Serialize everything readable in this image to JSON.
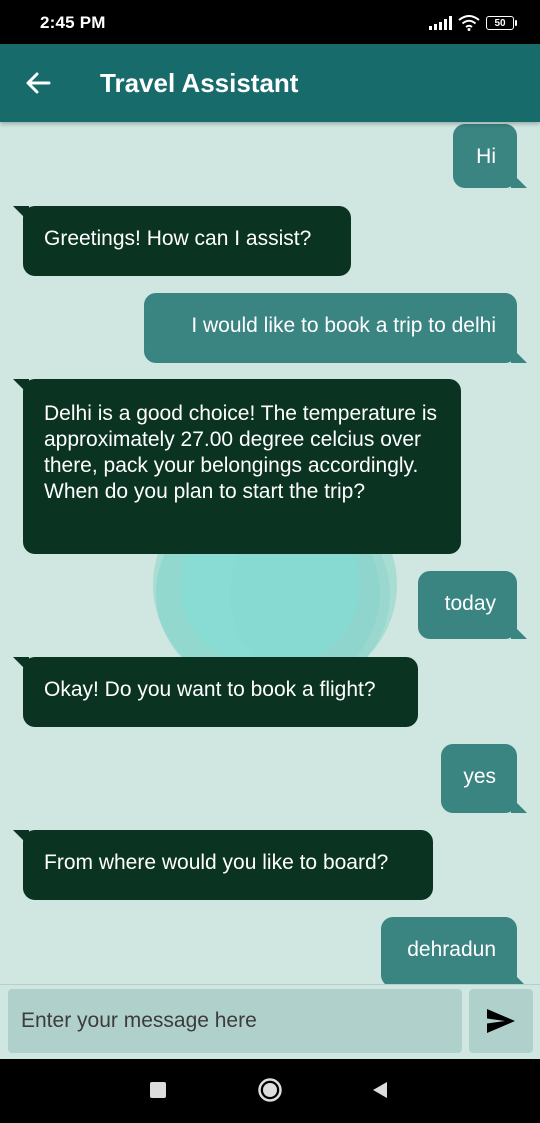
{
  "status_bar": {
    "time": "2:45 PM",
    "battery": "50",
    "icons": [
      "signal-icon",
      "wifi-icon",
      "battery-icon"
    ]
  },
  "app_bar": {
    "title": "Travel Assistant",
    "back_icon": "arrow-left-icon"
  },
  "messages": [
    {
      "sender": "user",
      "text": "Hi"
    },
    {
      "sender": "bot",
      "text": "Greetings! How can I assist?"
    },
    {
      "sender": "user",
      "text": "I would like to book a trip to delhi"
    },
    {
      "sender": "bot",
      "text": "Delhi is a good choice! The temperature is approximately 27.00 degree celcius over there, pack your belongings accordingly. When do you plan to start the trip?"
    },
    {
      "sender": "user",
      "text": "today"
    },
    {
      "sender": "bot",
      "text": "Okay! Do you want to book a flight?"
    },
    {
      "sender": "user",
      "text": "yes"
    },
    {
      "sender": "bot",
      "text": "From where would you like to board?"
    },
    {
      "sender": "user",
      "text": "dehradun"
    }
  ],
  "composer": {
    "placeholder": "Enter your message here",
    "send_icon": "send-icon"
  },
  "nav": {
    "icons": [
      "recent-apps-icon",
      "home-icon",
      "back-icon"
    ]
  },
  "colors": {
    "app_bar": "#176b6b",
    "background": "#d0e6e1",
    "bot_bubble": "#0a3322",
    "user_bubble": "#3a8482",
    "input": "#b0d1cb"
  }
}
